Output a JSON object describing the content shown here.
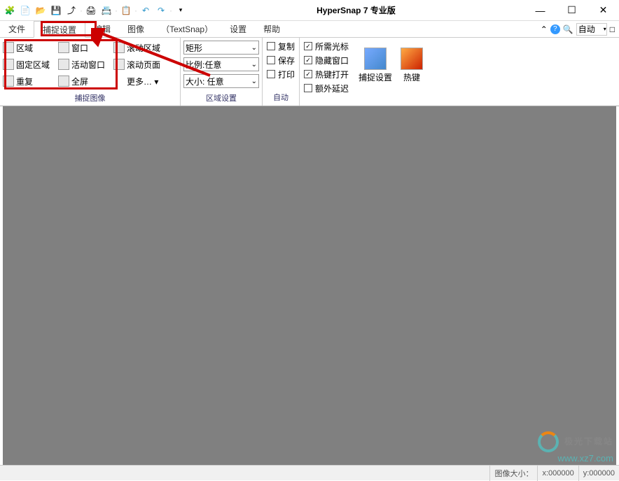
{
  "title": "HyperSnap 7 专业版",
  "qat_icons": [
    "app-icon",
    "new-icon",
    "open-icon",
    "save-icon",
    "export-icon",
    "sep",
    "print-icon",
    "email-icon",
    "sep",
    "clipboard-icon",
    "sep",
    "undo-icon",
    "redo-icon",
    "sep",
    "dropdown-icon"
  ],
  "winbtns": {
    "min": "—",
    "max": "☐",
    "close": "✕"
  },
  "menu": {
    "file": "文件",
    "capture": "捕捉设置",
    "edit": "编辑",
    "image": "图像",
    "textsnap": "（TextSnap）",
    "settings": "设置",
    "help": "帮助"
  },
  "menubar_right": {
    "caret": "⌃",
    "help": "?",
    "search": "🔍",
    "auto_label": "自动",
    "square": "□"
  },
  "ribbon": {
    "group1": {
      "label": "捕捉图像",
      "col1": [
        {
          "icon": "region-icon",
          "label": "区域"
        },
        {
          "icon": "fixed-region-icon",
          "label": "固定区域"
        },
        {
          "icon": "repeat-icon",
          "label": "重复"
        }
      ],
      "col2": [
        {
          "icon": "window-icon",
          "label": "窗口"
        },
        {
          "icon": "active-window-icon",
          "label": "活动窗口"
        },
        {
          "icon": "fullscreen-icon",
          "label": "全屏"
        }
      ],
      "col3": [
        {
          "icon": "scroll-region-icon",
          "label": "滚动区域"
        },
        {
          "icon": "scroll-page-icon",
          "label": "滚动页面"
        },
        {
          "icon": "more-icon",
          "label": "更多… ▾"
        }
      ]
    },
    "group2": {
      "label": "区域设置",
      "combos": [
        {
          "name": "shape",
          "value": "矩形"
        },
        {
          "name": "ratio",
          "value": "比例:任意"
        },
        {
          "name": "size",
          "value": "大小: 任意"
        }
      ]
    },
    "group3": {
      "label": "自动",
      "checks": [
        {
          "name": "copy",
          "label": "复制",
          "checked": false
        },
        {
          "name": "save",
          "label": "保存",
          "checked": false
        },
        {
          "name": "print",
          "label": "打印",
          "checked": false
        }
      ]
    },
    "group4": {
      "checks": [
        {
          "name": "need-cursor",
          "label": "所需光标",
          "checked": true
        },
        {
          "name": "hide-window",
          "label": "隐藏窗口",
          "checked": true
        },
        {
          "name": "hotkey-open",
          "label": "热键打开",
          "checked": true
        },
        {
          "name": "extra-delay",
          "label": "额外延迟",
          "checked": false
        }
      ]
    },
    "group5": {
      "btns": [
        {
          "name": "capture-settings",
          "label": "捕捉设置"
        },
        {
          "name": "hotkeys",
          "label": "热键"
        }
      ]
    }
  },
  "statusbar": {
    "size_label": "图像大小：",
    "x": "x:000000",
    "y": "y:000000"
  },
  "watermark": {
    "line1": "极光下载站",
    "line2": "www.xz7.com"
  }
}
